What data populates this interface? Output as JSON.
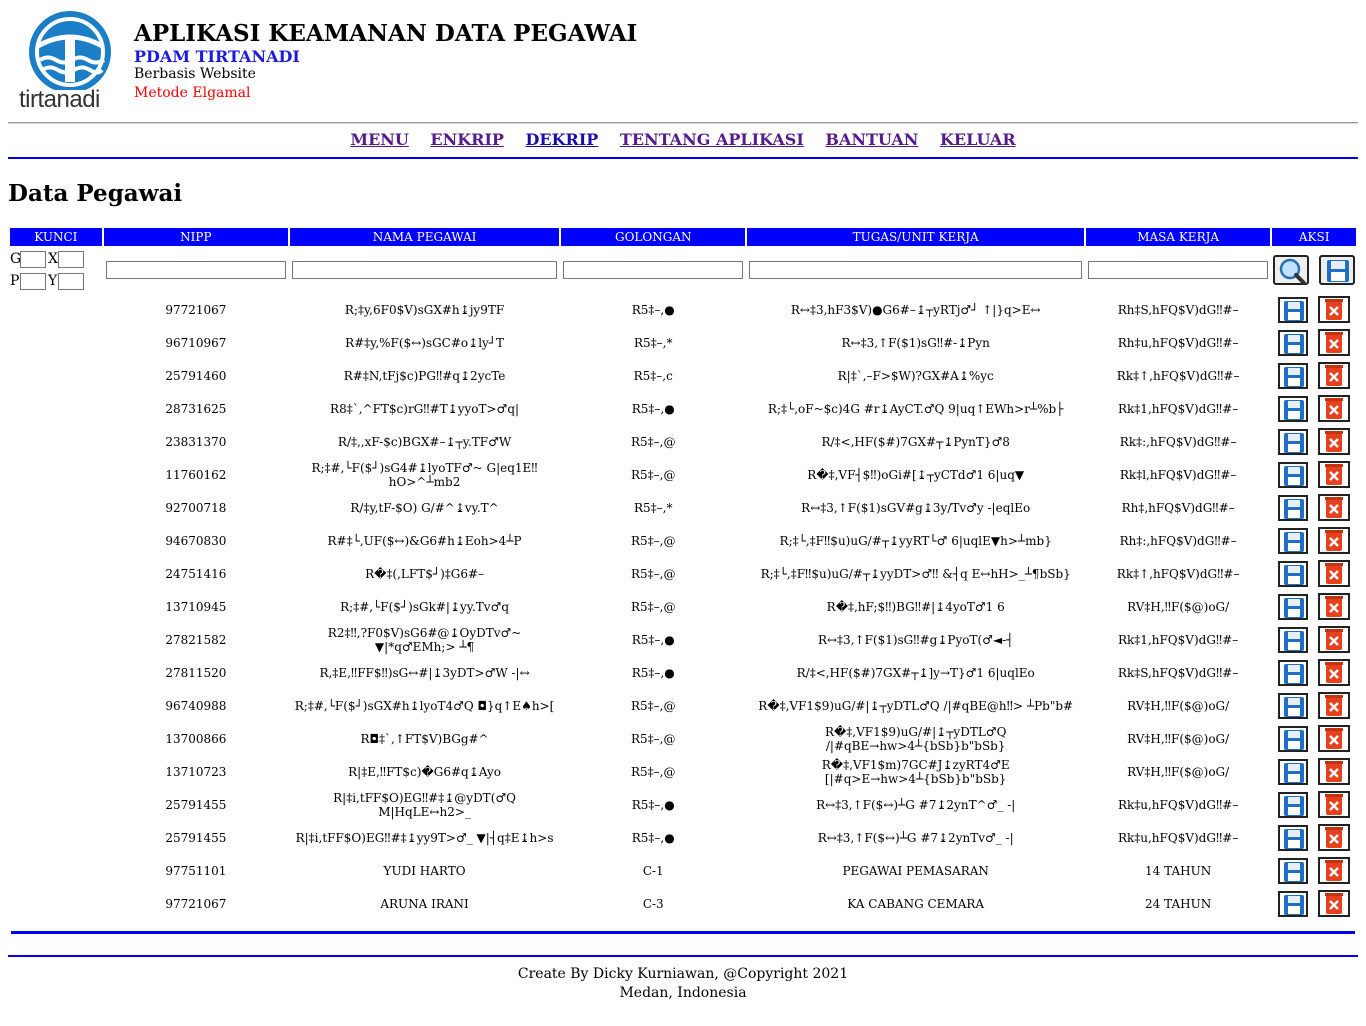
{
  "header": {
    "logo_text": "tirtanadi",
    "title": "APLIKASI KEAMANAN DATA PEGAWAI",
    "org": "PDAM TIRTANADI",
    "sub1": "Berbasis Website",
    "sub2": "Metode Elgamal"
  },
  "nav": [
    "MENU",
    "ENKRIP",
    "DEKRIP",
    "TENTANG APLIKASI",
    "BANTUAN",
    "KELUAR"
  ],
  "page_title": "Data Pegawai",
  "columns": [
    "KUNCI",
    "NIPP",
    "NAMA PEGAWAI",
    "GOLONGAN",
    "TUGAS/UNIT KERJA",
    "MASA KERJA",
    "AKSI"
  ],
  "kunci_labels": [
    "G",
    "X",
    "P",
    "Y"
  ],
  "rows": [
    {
      "nipp": "97721067",
      "nama": "R;‡y,6F0$V)sGX#h↨jy9TF",
      "gol": "R5‡–,●",
      "tugas": "R↔‡3,hF3$V)●G6#–↨┬yRTj♂┘ ↑|}q>E↔",
      "masa": "Rh‡S,hFQ$V)dG‼#–"
    },
    {
      "nipp": "96710967",
      "nama": "R#‡y,%F($↔)sGC#o↨ly┘T",
      "gol": "R5‡–,*",
      "tugas": "R↔‡3,↑F($1)sG‼#-↨Pyn",
      "masa": "Rh‡u,hFQ$V)dG‼#–"
    },
    {
      "nipp": "25791460",
      "nama": "R#‡N,tFj$c)PG‼#q↨2ycTe",
      "gol": "R5‡–,c",
      "tugas": "R|‡`,–F>$W)?GX#A↨%yc",
      "masa": "Rk‡↑,hFQ$V)dG‼#–"
    },
    {
      "nipp": "28731625",
      "nama": "R8‡`,^FT$c)rG‼#T↨yyoT>♂q|",
      "gol": "R5‡–,●",
      "tugas": "R;‡└,oF~$c)4G #r↨AyCT.♂Q 9|uq↑EWh>r┴%b├",
      "masa": "Rk‡1,hFQ$V)dG‼#–"
    },
    {
      "nipp": "23831370",
      "nama": "R/‡,,xF-$c)BGX#–↨┬y.TF♂W",
      "gol": "R5‡–,@",
      "tugas": "R/‡<,HF($#)7GX#┬↨PynT}♂8",
      "masa": "Rk‡:,hFQ$V)dG‼#–"
    },
    {
      "nipp": "11760162",
      "nama": "R;‡#,└F($┘)sG4#↨lyoTF♂~ G|eq1E‼hO>^┴mb2",
      "gol": "R5‡–,@",
      "tugas": "R�‡,VF┤$‼)oGi#[↨┬yCTd♂1 6|uq▼",
      "masa": "Rk‡l,hFQ$V)dG‼#–"
    },
    {
      "nipp": "92700718",
      "nama": "R/‡y,tF-$O) G/#^↨vy.T^",
      "gol": "R5‡–,*",
      "tugas": "R↔‡3,↑F($1)sGV#g↨3y/Tv♂y -|eqlEo",
      "masa": "Rh‡,hFQ$V)dG‼#–"
    },
    {
      "nipp": "94670830",
      "nama": "R#‡└,UF($↔)&G6#h↨Eoh>4┴P",
      "gol": "R5‡–,@",
      "tugas": "R;‡└,‡F‼$u)uG/#┬↨yyRT└♂ 6|uqlE▼h>┴mb}",
      "masa": "Rh‡:,hFQ$V)dG‼#–"
    },
    {
      "nipp": "24751416",
      "nama": "R�‡(,LFT$┘)‡G6#–",
      "gol": "R5‡–,@",
      "tugas": "R;‡└,‡F‼$u)uG/#┬↨yyDT>♂‼ &┤q E↔hH>_┴¶bSb}",
      "masa": "Rk‡↑,hFQ$V)dG‼#–"
    },
    {
      "nipp": "13710945",
      "nama": "R;‡#,└F($┘)sGk#|↨yy.Tv♂q",
      "gol": "R5‡–,@",
      "tugas": "R�‡,hF;$‼)BG‼#|↨4yoT♂1 6",
      "masa": "RV‡H,‼F($@)oG/"
    },
    {
      "nipp": "27821582",
      "nama": "R2‡‼,?F0$V)sG6#@↨OyDTv♂~ ▼|*q♂EMh;> ┴¶",
      "gol": "R5‡–,●",
      "tugas": "R↔‡3,↑F($1)sG‼#g↨PyoT(♂◄-┤",
      "masa": "Rk‡1,hFQ$V)dG‼#–"
    },
    {
      "nipp": "27811520",
      "nama": "R,‡E,‼FF$‼)sG↔#|↨3yDT>♂W -|↔",
      "gol": "R5‡–,●",
      "tugas": "R/‡<,HF($#)7GX#┬↨]y→T}♂1 6|uqlEo",
      "masa": "Rk‡S,hFQ$V)dG‼#–"
    },
    {
      "nipp": "96740988",
      "nama": "R;‡#,└F($┘)sGX#h↨lyoT4♂Q ◘}q↑E♠h>[",
      "gol": "R5‡–,@",
      "tugas": "R�‡,VF1$9)uG/#|↨┬yDTL♂Q /|#qBE@h‼> ┴Pb\"b#",
      "masa": "RV‡H,‼F($@)oG/"
    },
    {
      "nipp": "13700866",
      "nama": "R◘‡`,↑FT$V)BGg#^",
      "gol": "R5‡–,@",
      "tugas": "R�‡,VF1$9)uG/#|↨┬yDTL♂Q /|#qBE→hw>4┴{bSb}b\"bSb}",
      "masa": "RV‡H,‼F($@)oG/"
    },
    {
      "nipp": "13710723",
      "nama": "R|‡E,‼FT$c)�G6#q↨Ayo",
      "gol": "R5‡–,@",
      "tugas": "R�‡,VF1$m)7GC#J↨zyRT4♂E [|#q>E→hw>4┴{bSb}b\"bSb}",
      "masa": "RV‡H,‼F($@)oG/"
    },
    {
      "nipp": "25791455",
      "nama": "R|‡i,tFF$O)EG‼#‡↨@yDT(♂Q M|HqLE↔h2>_",
      "gol": "R5‡–,●",
      "tugas": "R↔‡3,↑F($↔)┴G #7↨2ynT^♂_ -|",
      "masa": "Rk‡u,hFQ$V)dG‼#–"
    },
    {
      "nipp": "25791455",
      "nama": "R|‡i,tFF$O)EG‼#‡↨yy9T>♂_ ▼|┤q‡E↨h>s",
      "gol": "R5‡–,●",
      "tugas": "R↔‡3,↑F($↔)┴G #7↨2ynTv♂_ -|",
      "masa": "Rk‡u,hFQ$V)dG‼#–"
    },
    {
      "nipp": "97751101",
      "nama": "YUDI HARTO",
      "gol": "C-1",
      "tugas": "PEGAWAI PEMASARAN",
      "masa": "14 TAHUN"
    },
    {
      "nipp": "97721067",
      "nama": "ARUNA IRANI",
      "gol": "C-3",
      "tugas": "KA CABANG CEMARA",
      "masa": "24 TAHUN"
    }
  ],
  "footer": {
    "line1": "Create By Dicky Kurniawan, @Copyright 2021",
    "line2": "Medan, Indonesia"
  },
  "colors": {
    "header_bg": "#0000ff",
    "title_org": "#1a1ae0",
    "subtitle_red": "#ff0000",
    "rule_blue": "#0000ee",
    "logo_blue": "#1c7ec6"
  }
}
